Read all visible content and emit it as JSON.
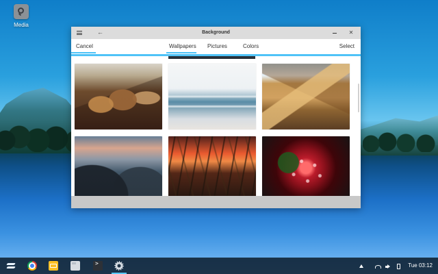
{
  "desktop": {
    "media_label": "Media"
  },
  "window": {
    "title": "Background"
  },
  "toolbar": {
    "cancel": "Cancel",
    "select": "Select",
    "tabs": [
      {
        "label": "Wallpapers"
      },
      {
        "label": "Pictures"
      },
      {
        "label": "Colors"
      }
    ]
  },
  "taskbar": {
    "clock": "Tue 03:12"
  }
}
